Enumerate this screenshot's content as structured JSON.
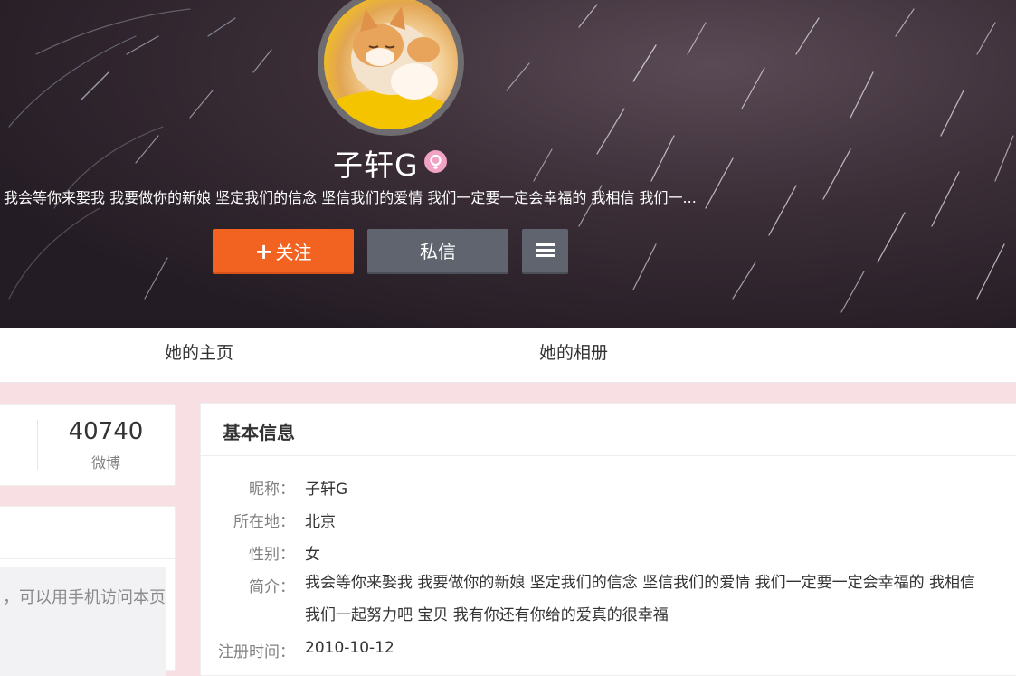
{
  "profile": {
    "nickname": "子轩G",
    "bio_short": "我会等你来娶我 我要做你的新娘 坚定我们的信念 坚信我们的爱情 我们一定要一定会幸福的 我相信 我们一...",
    "follow_label": "关注",
    "follow_plus": "+",
    "message_label": "私信",
    "gender_icon": "female-icon",
    "avatar_icon": "cat-avatar"
  },
  "tabs": [
    {
      "label": "她的主页"
    },
    {
      "label": "她的相册"
    }
  ],
  "stats": {
    "weibo_count": "40740",
    "weibo_label": "微博"
  },
  "mobile_card": {
    "text": "，可以用手机访问本页"
  },
  "info": {
    "title": "基本信息",
    "rows": [
      {
        "label": "昵称：",
        "value": "子轩G"
      },
      {
        "label": "所在地：",
        "value": "北京"
      },
      {
        "label": "性别：",
        "value": "女"
      },
      {
        "label": "简介：",
        "value": "我会等你来娶我 我要做你的新娘 坚定我们的信念 坚信我们的爱情 我们一定要一定会幸福的 我相信 我们一起努力吧 宝贝 我有你还有你给的爱真的很幸福"
      },
      {
        "label": "注册时间：",
        "value": "2010-10-12"
      }
    ]
  },
  "colors": {
    "follow_button": "#f26321",
    "message_button": "#5f646e",
    "page_background": "#f7dfe3"
  }
}
